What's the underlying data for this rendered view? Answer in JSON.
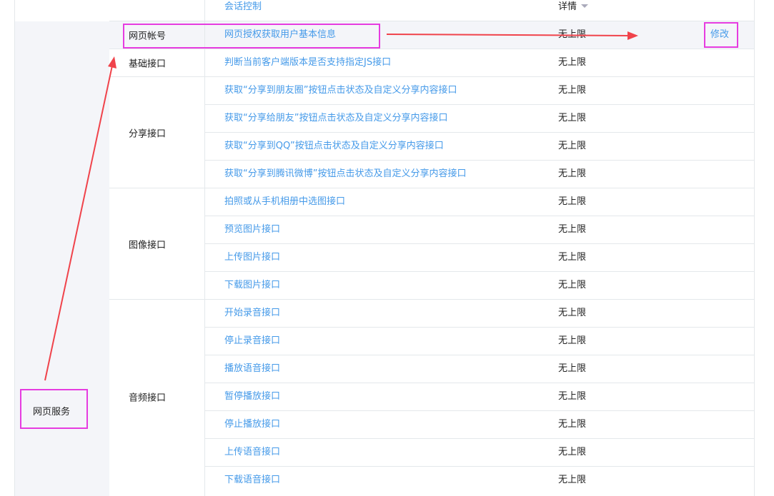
{
  "header": {
    "session_control": "会话控制",
    "detail_label": "详情"
  },
  "category": {
    "label": "网页服务"
  },
  "groups": [
    {
      "label": "网页帐号",
      "rows": [
        {
          "name": "网页授权获取用户基本信息",
          "limit": "无上限",
          "op": "修改"
        }
      ]
    },
    {
      "label": "基础接口",
      "rows": [
        {
          "name": "判断当前客户端版本是否支持指定JS接口",
          "limit": "无上限"
        }
      ]
    },
    {
      "label": "分享接口",
      "rows": [
        {
          "name": "获取“分享到朋友圈”按钮点击状态及自定义分享内容接口",
          "limit": "无上限"
        },
        {
          "name": "获取“分享给朋友”按钮点击状态及自定义分享内容接口",
          "limit": "无上限"
        },
        {
          "name": "获取“分享到QQ”按钮点击状态及自定义分享内容接口",
          "limit": "无上限"
        },
        {
          "name": "获取“分享到腾讯微博”按钮点击状态及自定义分享内容接口",
          "limit": "无上限"
        }
      ]
    },
    {
      "label": "图像接口",
      "rows": [
        {
          "name": "拍照或从手机相册中选图接口",
          "limit": "无上限"
        },
        {
          "name": "预览图片接口",
          "limit": "无上限"
        },
        {
          "name": "上传图片接口",
          "limit": "无上限"
        },
        {
          "name": "下载图片接口",
          "limit": "无上限"
        }
      ]
    },
    {
      "label": "音频接口",
      "rows": [
        {
          "name": "开始录音接口",
          "limit": "无上限"
        },
        {
          "name": "停止录音接口",
          "limit": "无上限"
        },
        {
          "name": "播放语音接口",
          "limit": "无上限"
        },
        {
          "name": "暂停播放接口",
          "limit": "无上限"
        },
        {
          "name": "停止播放接口",
          "limit": "无上限"
        },
        {
          "name": "上传语音接口",
          "limit": "无上限"
        },
        {
          "name": "下载语音接口",
          "limit": "无上限"
        }
      ]
    }
  ],
  "colors": {
    "link": "#459ae9",
    "highlight": "#e63ce0",
    "arrow": "#f0434b",
    "shade": "#f4f5f9",
    "border": "#e4e8eb"
  }
}
